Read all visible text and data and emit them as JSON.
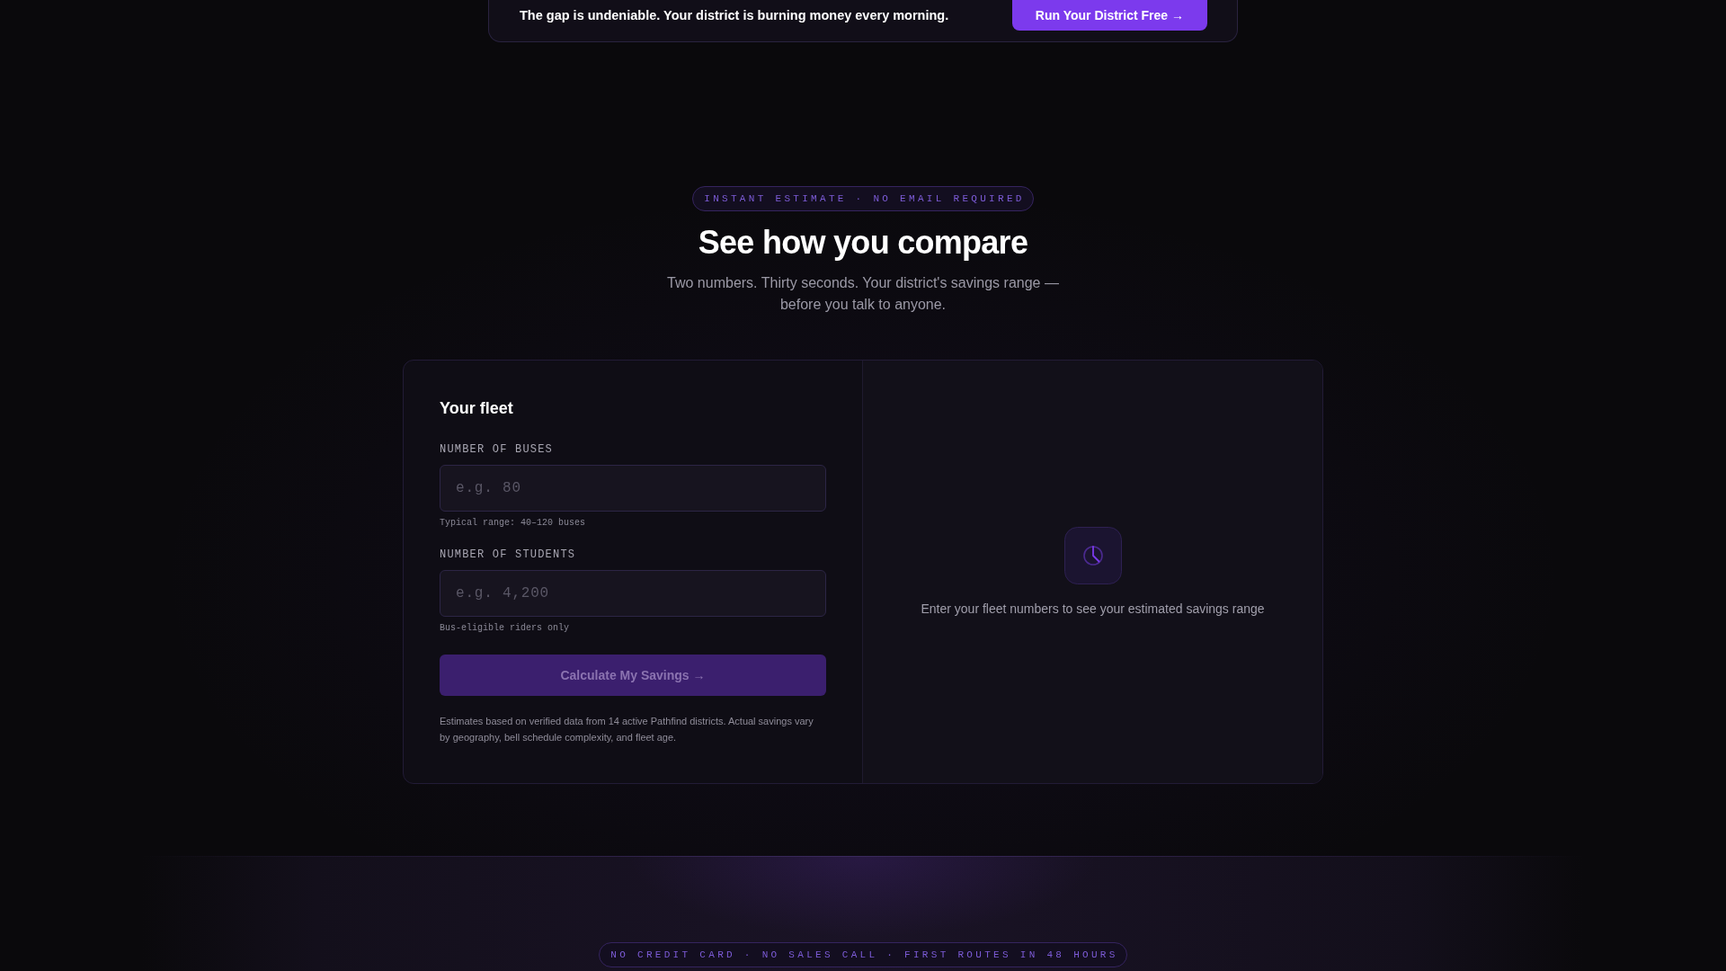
{
  "banner": {
    "text": "The gap is undeniable. Your district is burning money every morning.",
    "button": "Run Your District Free →"
  },
  "calculator": {
    "badge": "INSTANT ESTIMATE · NO EMAIL REQUIRED",
    "title": "See how you compare",
    "subtitle": "Two numbers. Thirty seconds. Your district's savings range — before you talk to anyone.",
    "form": {
      "title": "Your fleet",
      "fields": [
        {
          "label": "NUMBER OF BUSES",
          "placeholder": "e.g. 80",
          "hint": "Typical range: 40–120 buses"
        },
        {
          "label": "NUMBER OF STUDENTS",
          "placeholder": "e.g. 4,200",
          "hint": "Bus-eligible riders only"
        }
      ],
      "button": {
        "label": "Calculate My Savings →",
        "disabled": true
      },
      "footnote": "Estimates based on verified data from 14 active Pathfind districts. Actual savings vary by geography, bell schedule complexity, and fleet age."
    },
    "results": {
      "message": "Enter your fleet numbers to see your estimated savings range"
    }
  },
  "cta": {
    "badge": "NO CREDIT CARD · NO SALES CALL · FIRST ROUTES IN 48 HOURS"
  }
}
